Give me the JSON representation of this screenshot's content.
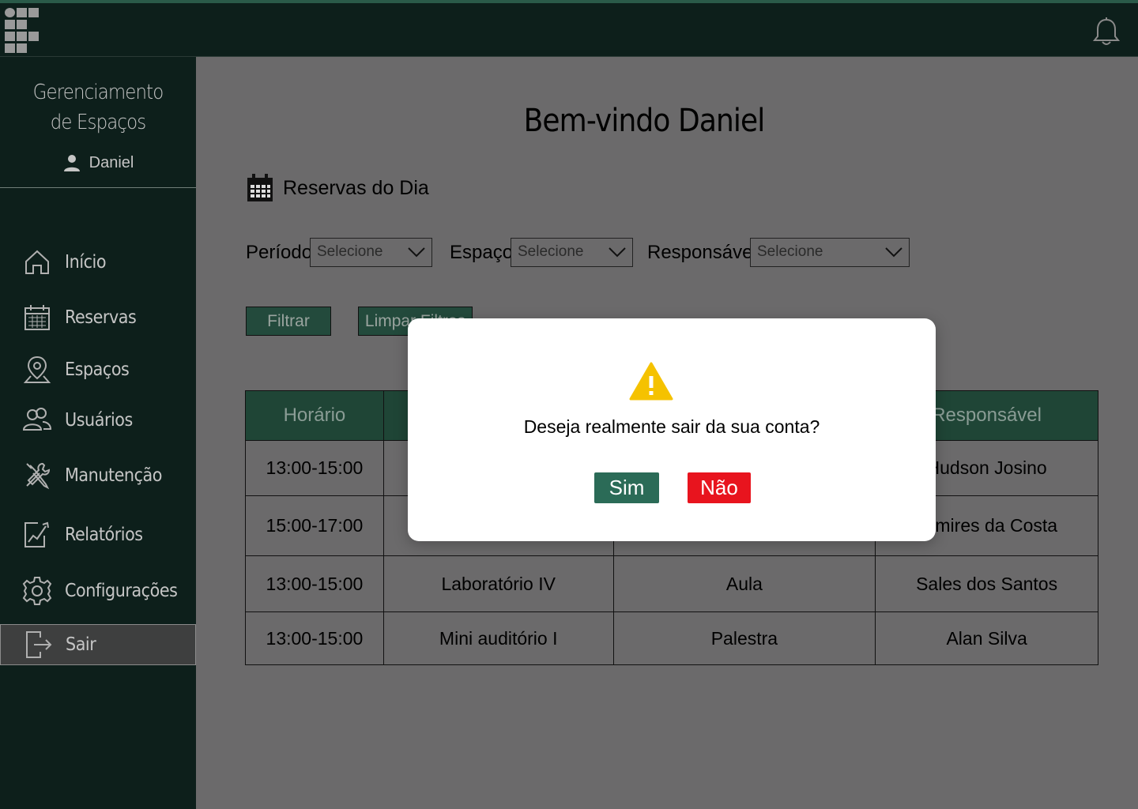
{
  "sidebar": {
    "title_line1": "Gerenciamento",
    "title_line2": "de Espaços",
    "user": "Daniel",
    "items": [
      {
        "label": "Início",
        "icon": "home-icon"
      },
      {
        "label": "Reservas",
        "icon": "calendar-icon"
      },
      {
        "label": "Espaços",
        "icon": "location-pin-icon"
      },
      {
        "label": "Usuários",
        "icon": "users-icon"
      },
      {
        "label": "Manutenção",
        "icon": "tools-icon"
      },
      {
        "label": "Relatórios",
        "icon": "report-chart-icon"
      },
      {
        "label": "Configurações",
        "icon": "gear-icon"
      },
      {
        "label": "Sair",
        "icon": "logout-icon"
      }
    ]
  },
  "main": {
    "welcome": "Bem-vindo Daniel",
    "section_title": "Reservas do Dia",
    "filters": {
      "periodo_label": "Período:",
      "periodo_value": "Selecione",
      "espaco_label": "Espaço:",
      "espaco_value": "Selecione",
      "responsavel_label": "Responsável:",
      "responsavel_value": "Selecione"
    },
    "filter_button": "Filtrar",
    "clear_button": "Limpar Filtros",
    "table": {
      "headers": [
        "Horário",
        "",
        "",
        "Responsável"
      ],
      "rows": [
        [
          "13:00-15:00",
          "",
          "",
          "Hudson Josino"
        ],
        [
          "15:00-17:00",
          "",
          "",
          "Tamires da Costa"
        ],
        [
          "13:00-15:00",
          "Laboratório IV",
          "Aula",
          "Sales dos Santos"
        ],
        [
          "13:00-15:00",
          "Mini auditório I",
          "Palestra",
          "Alan Silva"
        ]
      ]
    }
  },
  "dialog": {
    "message": "Deseja realmente sair da sua conta?",
    "confirm": "Sim",
    "cancel": "Não"
  },
  "colors": {
    "dark_bg": "#0d1f1b",
    "accent_green": "#2b6b57",
    "danger_red": "#e8141e",
    "warning_yellow": "#f5c200"
  }
}
